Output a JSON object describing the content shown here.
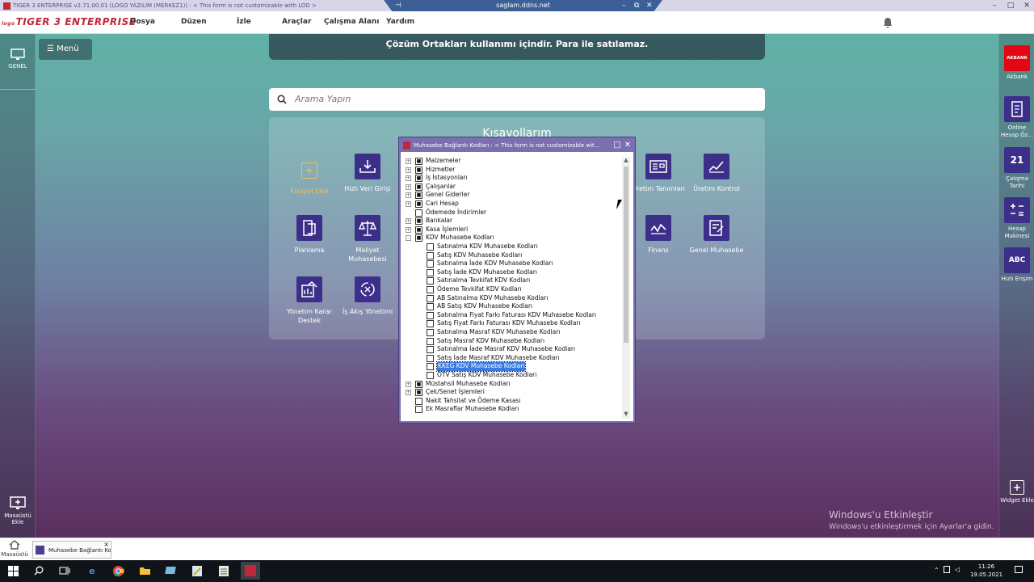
{
  "titlebar": {
    "text": "TIGER 3 ENTERPRISE v2.71.00.01 (LOGO YAZILIM (MERKEZ1)) : < This form is not customizable with LOD >"
  },
  "remote": {
    "host": "saglam.ddns.net"
  },
  "app": {
    "brand_prefix": "logo",
    "brand": "TIGER 3 ENTERPRISE"
  },
  "menu": [
    "Dosya",
    "Düzen",
    "İzle",
    "Araçlar",
    "Çalışma Alanı",
    "Yardım"
  ],
  "left_rail": {
    "top_label": "GENEL",
    "bottom_label": "Masaüstü Ekle"
  },
  "menu_button": "Menü",
  "notice": "Çözüm Ortakları kullanımı içindir. Para ile satılamaz.",
  "search": {
    "placeholder": "Arama Yapın"
  },
  "shortcuts": {
    "title": "Kısayollarım",
    "tiles": [
      {
        "label": "Kısayol Ekle",
        "icon": "plus-icon"
      },
      {
        "label": "Hızlı Veri Girişi",
        "icon": "download-tray-icon"
      },
      {
        "label": "Üretim Tanımları",
        "icon": "production-definitions-icon"
      },
      {
        "label": "Üretim Kontrol",
        "icon": "line-chart-icon"
      },
      {
        "label": "Planlama",
        "icon": "planning-icon"
      },
      {
        "label": "Maliyet Muhasebesi",
        "icon": "scale-icon"
      },
      {
        "label": "Finans",
        "icon": "finance-chart-icon"
      },
      {
        "label": "Genel Muhasebe",
        "icon": "ledger-edit-icon"
      },
      {
        "label": "Yönetim Karar Destek",
        "icon": "report-chart-icon"
      },
      {
        "label": "İş Akış Yönetimi",
        "icon": "recycle-icon"
      }
    ]
  },
  "right_rail": [
    {
      "label": "Akbank",
      "icon": "akbank-logo-icon",
      "icon_text": "AKBANK",
      "color": "#e30613"
    },
    {
      "label": "Online Hesap Öz...",
      "icon": "document-icon",
      "icon_text": ""
    },
    {
      "label": "Çalışma Tarihi",
      "icon": "calendar-icon",
      "icon_text": "21"
    },
    {
      "label": "Hesap Makinesi",
      "icon": "calculator-icon",
      "icon_text": ""
    },
    {
      "label": "Hızlı Erişim",
      "icon": "abc-search-icon",
      "icon_text": "ABC"
    },
    {
      "label": "Widget Ekle",
      "icon": "plus-icon",
      "icon_text": "+"
    }
  ],
  "dialog": {
    "title": "Muhasebe Bağlantı Kodları : < This form is not customizable wit...",
    "items": [
      {
        "label": "Malzemeler",
        "level": 0,
        "expander": "+",
        "checked": true
      },
      {
        "label": "Hizmetler",
        "level": 0,
        "expander": "+",
        "checked": true
      },
      {
        "label": "İş İstasyonları",
        "level": 0,
        "expander": "+",
        "checked": true
      },
      {
        "label": "Çalışanlar",
        "level": 0,
        "expander": "+",
        "checked": true
      },
      {
        "label": "Genel Giderler",
        "level": 0,
        "expander": "+",
        "checked": true
      },
      {
        "label": "Cari Hesap",
        "level": 0,
        "expander": "+",
        "checked": true
      },
      {
        "label": "Ödemede İndirimler",
        "level": 0,
        "expander": "",
        "checked": false
      },
      {
        "label": "Bankalar",
        "level": 0,
        "expander": "+",
        "checked": true
      },
      {
        "label": "Kasa İşlemleri",
        "level": 0,
        "expander": "+",
        "checked": true
      },
      {
        "label": "KDV Muhasebe Kodları",
        "level": 0,
        "expander": "-",
        "checked": true
      },
      {
        "label": "Satınalma KDV Muhasebe Kodları",
        "level": 1,
        "expander": "",
        "checked": false
      },
      {
        "label": "Satış KDV Muhasebe Kodları",
        "level": 1,
        "expander": "",
        "checked": false
      },
      {
        "label": "Satınalma İade KDV Muhasebe Kodları",
        "level": 1,
        "expander": "",
        "checked": false
      },
      {
        "label": "Satış İade KDV Muhasebe Kodları",
        "level": 1,
        "expander": "",
        "checked": false
      },
      {
        "label": "Satınalma Tevkifat KDV Kodları",
        "level": 1,
        "expander": "",
        "checked": false
      },
      {
        "label": "Ödeme Tevkifat KDV Kodları",
        "level": 1,
        "expander": "",
        "checked": false
      },
      {
        "label": "AB Satınalma KDV Muhasebe Kodları",
        "level": 1,
        "expander": "",
        "checked": false
      },
      {
        "label": "AB Satış KDV Muhasebe Kodları",
        "level": 1,
        "expander": "",
        "checked": false
      },
      {
        "label": "Satınalma Fiyat Farkı Faturası KDV Muhasebe Kodları",
        "level": 1,
        "expander": "",
        "checked": false
      },
      {
        "label": "Satış Fiyat Farkı Faturası KDV Muhasebe Kodları",
        "level": 1,
        "expander": "",
        "checked": false
      },
      {
        "label": "Satınalma Masraf KDV Muhasebe Kodları",
        "level": 1,
        "expander": "",
        "checked": false
      },
      {
        "label": "Satış Masraf KDV Muhasebe Kodları",
        "level": 1,
        "expander": "",
        "checked": false
      },
      {
        "label": "Satınalma İade Masraf KDV Muhasebe Kodları",
        "level": 1,
        "expander": "",
        "checked": false
      },
      {
        "label": "Satış İade Masraf KDV Muhasebe Kodları",
        "level": 1,
        "expander": "",
        "checked": false
      },
      {
        "label": "KKEG KDV Muhasebe Kodları",
        "level": 1,
        "expander": "",
        "checked": false,
        "selected": true
      },
      {
        "label": "ÖTV Satış KDV Muhasebe Kodları",
        "level": 1,
        "expander": "",
        "checked": false
      },
      {
        "label": "Müstahsil Muhasebe Kodları",
        "level": 0,
        "expander": "+",
        "checked": true
      },
      {
        "label": "Çek/Senet İşlemleri",
        "level": 0,
        "expander": "+",
        "checked": true
      },
      {
        "label": "Nakit Tahsilat ve Ödeme Kasası",
        "level": 0,
        "expander": "",
        "checked": false
      },
      {
        "label": "Ek Masraflar Muhasebe Kodları",
        "level": 0,
        "expander": "",
        "checked": false
      }
    ]
  },
  "windows_activation": {
    "line1": "Windows'u Etkinleştir",
    "line2": "Windows'u etkinleştirmek için Ayarlar'a gidin."
  },
  "bottom_bar": {
    "home_label": "Masaüstü",
    "tab_label": "Muhasebe Bağlantı Ko"
  },
  "taskbar": {
    "time": "11:26",
    "date": "19.05.2021"
  }
}
